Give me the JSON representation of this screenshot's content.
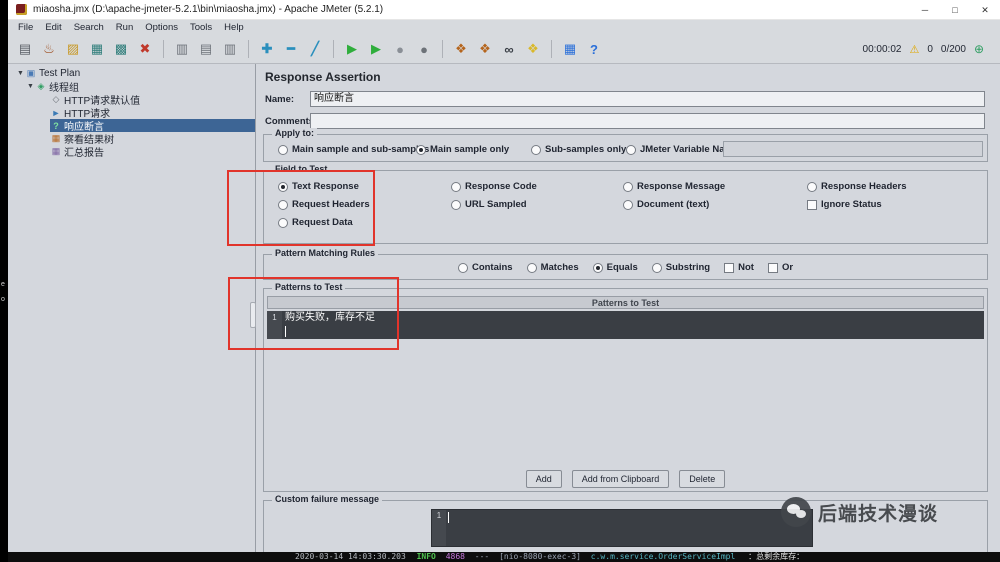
{
  "window": {
    "title": "miaosha.jmx (D:\\apache-jmeter-5.2.1\\bin\\miaosha.jmx) - Apache JMeter (5.2.1)",
    "controls": {
      "minimize": "─",
      "maximize": "□",
      "close": "✕"
    }
  },
  "menu": {
    "items": [
      "File",
      "Edit",
      "Search",
      "Run",
      "Options",
      "Tools",
      "Help"
    ]
  },
  "toolbar": {
    "icons": [
      {
        "name": "new-file-icon",
        "glyph": "▤",
        "style": "color:#5a5f66"
      },
      {
        "name": "templates-icon",
        "glyph": "♨",
        "style": "color:#9c4a1a"
      },
      {
        "name": "open-file-icon",
        "glyph": "▨",
        "style": "color:#c89a2a"
      },
      {
        "name": "save-icon",
        "glyph": "▦",
        "style": "color:#2e7d7a"
      },
      {
        "name": "save-as-icon",
        "glyph": "▩",
        "style": "color:#2e7d7a"
      },
      {
        "name": "cut-icon",
        "glyph": "✖",
        "style": "color:#c0392b"
      },
      {
        "name": "copy-icon",
        "glyph": "▥",
        "style": "color:#6e737a"
      },
      {
        "name": "paste-icon",
        "glyph": "▤",
        "style": "color:#6e737a"
      },
      {
        "name": "duplicate-icon",
        "glyph": "▥",
        "style": "color:#6e737a"
      },
      {
        "name": "add-element-icon",
        "glyph": "✚",
        "style": "color:#2a8fbd;font-weight:bold"
      },
      {
        "name": "remove-element-icon",
        "glyph": "━",
        "style": "color:#2a8fbd;font-weight:bold"
      },
      {
        "name": "toggle-icon",
        "glyph": "╱",
        "style": "color:#2a8fbd;font-weight:bold"
      },
      {
        "name": "start-icon",
        "glyph": "▶",
        "style": "color:#2fae3c"
      },
      {
        "name": "start-no-pauses-icon",
        "glyph": "▶",
        "style": "color:#2fae3c"
      },
      {
        "name": "stop-icon",
        "glyph": "●",
        "style": "color:#8a8f96"
      },
      {
        "name": "shutdown-icon",
        "glyph": "●",
        "style": "color:#6d7278"
      },
      {
        "name": "clear-icon",
        "glyph": "❖",
        "style": "color:#b5651d"
      },
      {
        "name": "clear-all-icon",
        "glyph": "❖",
        "style": "color:#b5651d"
      },
      {
        "name": "search-icon",
        "glyph": "∞",
        "style": "color:#3a3f46;font-weight:bold"
      },
      {
        "name": "search-reset-icon",
        "glyph": "❖",
        "style": "color:#d9b82a"
      },
      {
        "name": "function-helper-icon",
        "glyph": "▦",
        "style": "color:#2a6fd9"
      },
      {
        "name": "help-icon",
        "glyph": "?",
        "style": "color:#2a6fd9;font-weight:bold"
      }
    ],
    "status": {
      "elapsed": "00:00:02",
      "warning_icon": "⚠",
      "warning_count": "0",
      "threads": "0/200",
      "remote_icon": "⊕"
    }
  },
  "tree": {
    "expand_glyph": "▼",
    "items": [
      {
        "label": "Test Plan",
        "icon": "▣",
        "istyle": "color:#4a7ab5"
      },
      {
        "label": "线程组",
        "icon": "◈",
        "istyle": "color:#2f9e62"
      },
      {
        "label": "HTTP请求默认值",
        "icon": "◇",
        "istyle": "color:#6e737a"
      },
      {
        "label": "HTTP请求",
        "icon": "►",
        "istyle": "color:#3a7ab5"
      },
      {
        "label": "响应断言",
        "icon": "?",
        "istyle": "color:#7fe3a0;font-weight:bold"
      },
      {
        "label": "察看结果树",
        "icon": "▦",
        "istyle": "color:#b5651d"
      },
      {
        "label": "汇总报告",
        "icon": "▦",
        "istyle": "color:#7a5fa0"
      }
    ]
  },
  "main": {
    "title": "Response Assertion",
    "name": {
      "label": "Name:",
      "value": "响应断言"
    },
    "comments": {
      "label": "Comments:",
      "value": ""
    },
    "apply_to": {
      "legend": "Apply to:",
      "options": [
        {
          "label": "Main sample and sub-samples",
          "selected": false
        },
        {
          "label": "Main sample only",
          "selected": true
        },
        {
          "label": "Sub-samples only",
          "selected": false
        },
        {
          "label": "JMeter Variable Name to use",
          "selected": false
        }
      ]
    },
    "field_to_test": {
      "legend": "Field to Test",
      "options": [
        {
          "label": "Text Response",
          "type": "radio",
          "selected": true
        },
        {
          "label": "Response Code",
          "type": "radio",
          "selected": false
        },
        {
          "label": "Response Message",
          "type": "radio",
          "selected": false
        },
        {
          "label": "Response Headers",
          "type": "radio",
          "selected": false
        },
        {
          "label": "Request Headers",
          "type": "radio",
          "selected": false
        },
        {
          "label": "URL Sampled",
          "type": "radio",
          "selected": false
        },
        {
          "label": "Document (text)",
          "type": "radio",
          "selected": false
        },
        {
          "label": "Ignore Status",
          "type": "checkbox",
          "selected": false
        },
        {
          "label": "Request Data",
          "type": "radio",
          "selected": false
        }
      ]
    },
    "pattern_rules": {
      "legend": "Pattern Matching Rules",
      "options": [
        {
          "label": "Contains",
          "type": "radio",
          "selected": false
        },
        {
          "label": "Matches",
          "type": "radio",
          "selected": false
        },
        {
          "label": "Equals",
          "type": "radio",
          "selected": true
        },
        {
          "label": "Substring",
          "type": "radio",
          "selected": false
        },
        {
          "label": "Not",
          "type": "checkbox",
          "selected": false
        },
        {
          "label": "Or",
          "type": "checkbox",
          "selected": false
        }
      ]
    },
    "patterns": {
      "legend": "Patterns to Test",
      "column_header": "Patterns to Test",
      "rows": [
        {
          "line": "1",
          "value": "购买失败，库存不足"
        }
      ],
      "buttons": [
        {
          "label": "Add"
        },
        {
          "label": "Add from Clipboard"
        },
        {
          "label": "Delete"
        }
      ]
    },
    "custom_failure": {
      "legend": "Custom failure message",
      "line": "1",
      "value": ""
    }
  },
  "watermark": {
    "text": "后端技术漫谈"
  },
  "console_log": {
    "timestamp": "2020-03-14 14:03:30.203",
    "level": "INFO",
    "pid": "4868",
    "separator": "---",
    "thread": "[nio-8080-exec-3]",
    "logger": "c.w.m.service.OrderServiceImpl",
    "message": "：总剩余库存："
  },
  "edge_text": {
    "a": "e",
    "b": "o"
  },
  "colors": {
    "selection": "#3d6595",
    "annotation": "#e1342b",
    "panel": "#d4d7dd"
  }
}
